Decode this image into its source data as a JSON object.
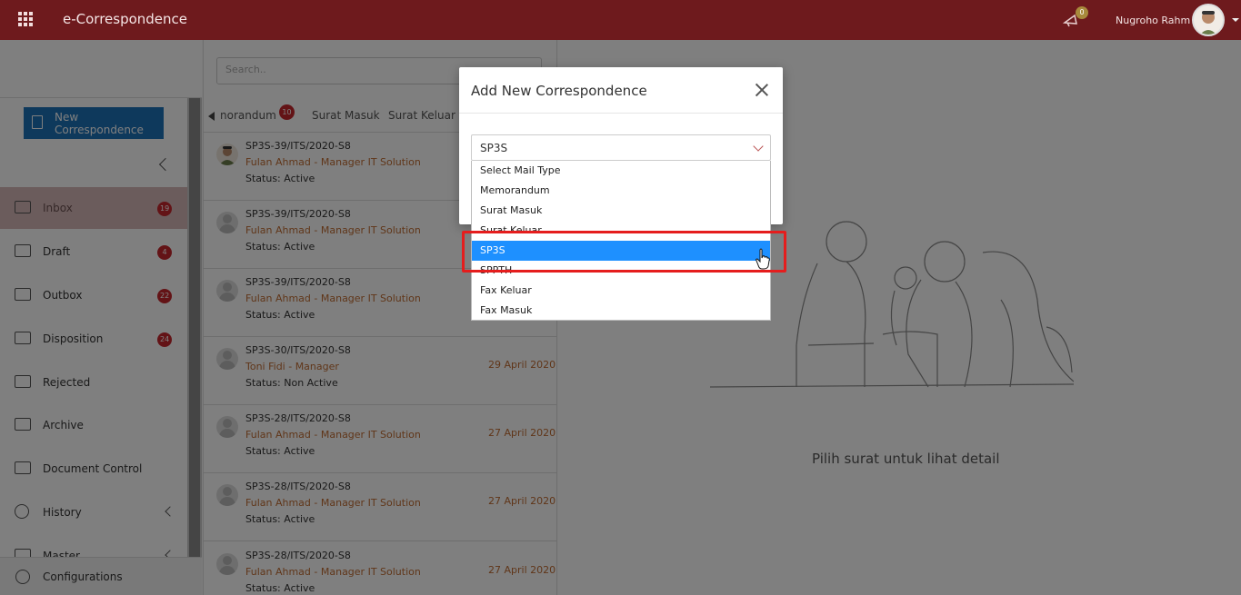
{
  "header": {
    "app_title": "e-Correspondence",
    "notification_count": "0",
    "user_name": "Nugroho Rahm"
  },
  "sidebar": {
    "new_button": "New Correspondence",
    "items": [
      {
        "label": "Inbox",
        "badge": "19",
        "icon": "inbox-icon"
      },
      {
        "label": "Draft",
        "badge": "4",
        "icon": "draft-icon"
      },
      {
        "label": "Outbox",
        "badge": "22",
        "icon": "outbox-icon"
      },
      {
        "label": "Disposition",
        "badge": "24",
        "icon": "disposition-icon"
      },
      {
        "label": "Rejected",
        "badge": "",
        "icon": "rejected-icon"
      },
      {
        "label": "Archive",
        "badge": "",
        "icon": "archive-icon"
      },
      {
        "label": "Document Control",
        "badge": "",
        "icon": "document-control-icon"
      },
      {
        "label": "History",
        "badge": "",
        "icon": "history-icon"
      },
      {
        "label": "Master",
        "badge": "",
        "icon": "master-icon"
      }
    ],
    "configurations": "Configurations"
  },
  "list": {
    "search_placeholder": "Search..",
    "tabs": [
      {
        "label": "norandum",
        "badge": "10"
      },
      {
        "label": "Surat Masuk"
      },
      {
        "label": "Surat Keluar"
      }
    ],
    "mails": [
      {
        "number": "SP3S-39/ITS/2020-S8",
        "from": "Fulan Ahmad - Manager IT Solution",
        "status": "Status: Active",
        "date": ""
      },
      {
        "number": "SP3S-39/ITS/2020-S8",
        "from": "Fulan Ahmad - Manager IT Solution",
        "status": "Status: Active",
        "date": ""
      },
      {
        "number": "SP3S-39/ITS/2020-S8",
        "from": "Fulan Ahmad - Manager IT Solution",
        "status": "Status: Active",
        "date": ""
      },
      {
        "number": "SP3S-30/ITS/2020-S8",
        "from": "Toni Fidi - Manager",
        "status": "Status: Non Active",
        "date": "29 April 2020"
      },
      {
        "number": "SP3S-28/ITS/2020-S8",
        "from": "Fulan Ahmad - Manager IT Solution",
        "status": "Status: Active",
        "date": "27 April 2020"
      },
      {
        "number": "SP3S-28/ITS/2020-S8",
        "from": "Fulan Ahmad - Manager IT Solution",
        "status": "Status: Active",
        "date": "27 April 2020"
      },
      {
        "number": "SP3S-28/ITS/2020-S8",
        "from": "Fulan Ahmad - Manager IT Solution",
        "status": "Status: Active",
        "date": "27 April 2020"
      }
    ]
  },
  "detail": {
    "empty_text": "Pilih surat untuk lihat detail"
  },
  "modal": {
    "title": "Add New Correspondence",
    "select_value": "SP3S",
    "options": [
      "Select Mail Type",
      "Memorandum",
      "Surat Masuk",
      "Surat Keluar",
      "SP3S",
      "SPPTH",
      "Fax Keluar",
      "Fax Masuk"
    ],
    "selected_index": 4
  },
  "colors": {
    "topbar": "#6e1a1d",
    "accent_button": "#1d72b8",
    "badge": "#c7262d",
    "selected_option": "#1e90ff",
    "highlight": "#e51d1d",
    "sender_text": "#c16d33"
  }
}
